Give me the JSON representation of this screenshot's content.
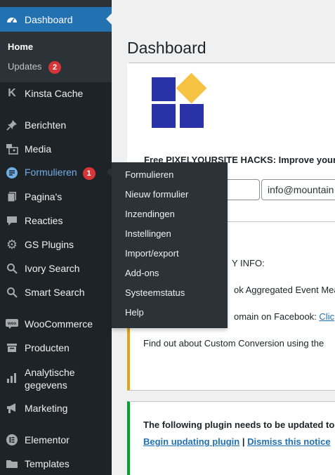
{
  "sidebar": {
    "dashboard_label": "Dashboard",
    "submenu": {
      "home": "Home",
      "updates": "Updates",
      "updates_count": "2"
    },
    "items": [
      {
        "label": "Kinsta Cache",
        "icon": "kinsta-icon"
      },
      {
        "label": "Berichten",
        "icon": "pin-icon"
      },
      {
        "label": "Media",
        "icon": "media-icon"
      },
      {
        "label": "Formulieren",
        "icon": "forms-icon",
        "badge": "1"
      },
      {
        "label": "Pagina's",
        "icon": "pages-icon"
      },
      {
        "label": "Reacties",
        "icon": "comments-icon"
      },
      {
        "label": "GS Plugins",
        "icon": "gear-icon"
      },
      {
        "label": "Ivory Search",
        "icon": "search-icon"
      },
      {
        "label": "Smart Search",
        "icon": "search-icon"
      },
      {
        "label": "WooCommerce",
        "icon": "woo-icon"
      },
      {
        "label": "Producten",
        "icon": "products-icon"
      },
      {
        "label": "Analytische gegevens",
        "line1": "Analytische",
        "line2": "gegevens",
        "icon": "analytics-icon"
      },
      {
        "label": "Marketing",
        "icon": "megaphone-icon"
      },
      {
        "label": "Elementor",
        "icon": "elementor-icon"
      },
      {
        "label": "Templates",
        "icon": "folder-icon"
      }
    ]
  },
  "flyout": {
    "items": [
      "Formulieren",
      "Nieuw formulier",
      "Inzendingen",
      "Instellingen",
      "Import/export",
      "Add-ons",
      "Systeemstatus",
      "Help"
    ]
  },
  "main": {
    "title": "Dashboard",
    "notice1": {
      "text": "Free PIXELYOURSITE HACKS: Improve your",
      "email_value": "info@mountain"
    },
    "notice2": {
      "heading_visible": "Y INFO:",
      "line1_visible": "ok Aggregated Event Mea",
      "line2_visible": "omain on Facebook:",
      "line2_link": "Clic",
      "line3": "Find out about Custom Conversion using the"
    },
    "notice3": {
      "text": "The following plugin needs to be updated to",
      "link1": "Begin updating plugin",
      "separator": "|",
      "link2": "Dismiss this notice"
    }
  },
  "colors": {
    "sidebar": "#1d2327",
    "active": "#2271b1",
    "badge": "#d63638",
    "warning": "#dba617",
    "success": "#00a32a"
  }
}
